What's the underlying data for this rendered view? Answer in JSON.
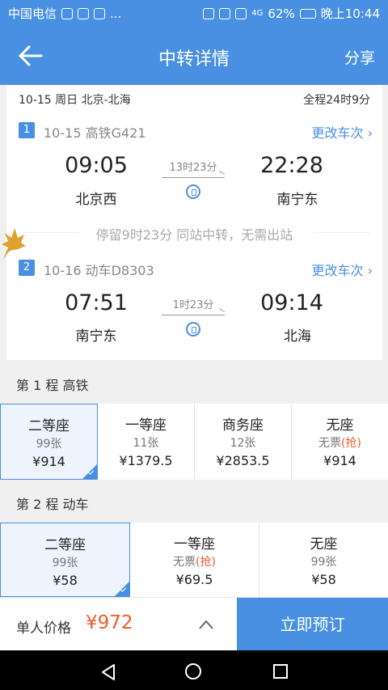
{
  "status_bar": {
    "carrier": "中国电信",
    "extra_dots": "...",
    "battery": "62%",
    "time": "晚上10:44",
    "network": "4G"
  },
  "header": {
    "title": "中转详情",
    "share": "分享"
  },
  "trip": {
    "summary": "10-15 周日 北京-北海",
    "total": "全程24时9分",
    "legs": [
      {
        "no": "1",
        "info": "10-15 高铁G421",
        "change": "更改车次",
        "dep_time": "09:05",
        "dep_station": "北京西",
        "duration": "13时23分",
        "arr_time": "22:28",
        "arr_station": "南宁东"
      },
      {
        "no": "2",
        "info": "10-16 动车D8303",
        "change": "更改车次",
        "dep_time": "07:51",
        "dep_station": "南宁东",
        "duration": "1时23分",
        "arr_time": "09:14",
        "arr_station": "北海"
      }
    ],
    "stopover": "停留9时23分 同站中转，无需出站"
  },
  "sections": [
    {
      "label": "第 1 程  高铁",
      "seats": [
        {
          "name": "二等座",
          "count": "99张",
          "grab": "",
          "price": "¥914",
          "selected": true
        },
        {
          "name": "一等座",
          "count": "11张",
          "grab": "",
          "price": "¥1379.5",
          "selected": false
        },
        {
          "name": "商务座",
          "count": "12张",
          "grab": "",
          "price": "¥2853.5",
          "selected": false
        },
        {
          "name": "无座",
          "count": "无票",
          "grab": "(抢)",
          "price": "¥914",
          "selected": false
        }
      ]
    },
    {
      "label": "第 2 程  动车",
      "seats": [
        {
          "name": "二等座",
          "count": "99张",
          "grab": "",
          "price": "¥58",
          "selected": true
        },
        {
          "name": "一等座",
          "count": "无票",
          "grab": "(抢)",
          "price": "¥69.5",
          "selected": false
        },
        {
          "name": "无座",
          "count": "99张",
          "grab": "",
          "price": "¥58",
          "selected": false
        }
      ]
    }
  ],
  "footer": {
    "label": "单人价格",
    "price": "¥972",
    "book": "立即预订"
  },
  "colors": {
    "primary": "#4a90e2",
    "accent": "#f25c2b"
  }
}
